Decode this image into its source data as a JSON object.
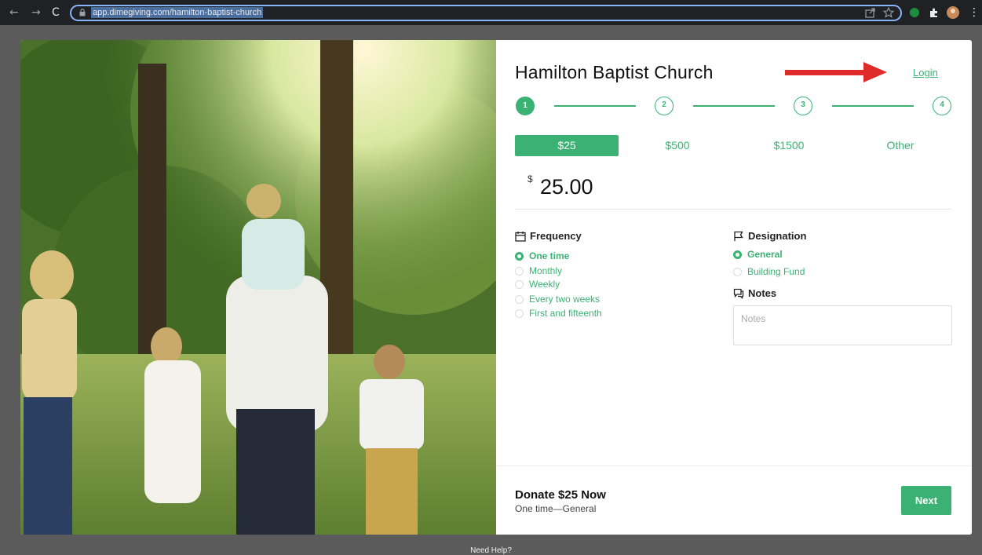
{
  "browser": {
    "url": "app.dimegiving.com/hamilton-baptist-church",
    "back_icon": "arrow-left-icon",
    "forward_icon": "arrow-right-icon",
    "reload_icon": "reload-icon"
  },
  "church": {
    "name": "Hamilton Baptist Church",
    "login_label": "Login"
  },
  "steps": [
    "1",
    "2",
    "3",
    "4"
  ],
  "amounts": {
    "options": [
      "$25",
      "$500",
      "$1500",
      "Other"
    ],
    "selected_index": 0
  },
  "amount": {
    "currency": "$",
    "value": "25.00"
  },
  "frequency": {
    "title": "Frequency",
    "options": [
      "One time",
      "Monthly",
      "Weekly",
      "Every two weeks",
      "First and fifteenth"
    ],
    "selected": "One time"
  },
  "designation": {
    "title": "Designation",
    "options": [
      "General",
      "Building Fund"
    ],
    "selected": "General"
  },
  "notes": {
    "title": "Notes",
    "placeholder": "Notes"
  },
  "footer": {
    "title": "Donate $25 Now",
    "subtitle": "One time—General",
    "next_label": "Next"
  },
  "help": "Need Help?",
  "colors": {
    "accent": "#3bb273",
    "annotation_arrow": "#e02b2b",
    "browser_bg": "#202124"
  }
}
